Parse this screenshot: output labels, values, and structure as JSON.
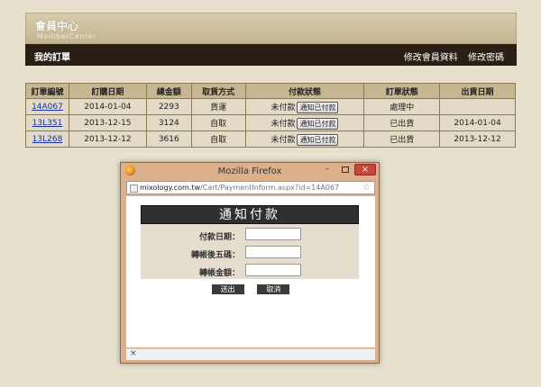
{
  "header": {
    "site_title": "會員中心",
    "site_subtitle": "MemberCenter",
    "page_heading": "我的訂單",
    "links": [
      "修改會員資料",
      "修改密碼"
    ]
  },
  "orders": {
    "columns": [
      "訂單編號",
      "訂購日期",
      "總金額",
      "取貨方式",
      "付款狀態",
      "訂單狀態",
      "出貨日期"
    ],
    "rows": [
      {
        "id": "14A067",
        "order_date": "2014-01-04",
        "total": "2293",
        "delivery": "貨運",
        "payment_status": "未付款",
        "notify_label": "通知已付款",
        "order_status": "處理中",
        "ship_date": ""
      },
      {
        "id": "13L351",
        "order_date": "2013-12-15",
        "total": "3124",
        "delivery": "自取",
        "payment_status": "未付款",
        "notify_label": "通知已付款",
        "order_status": "已出貨",
        "ship_date": "2014-01-04"
      },
      {
        "id": "13L268",
        "order_date": "2013-12-12",
        "total": "3616",
        "delivery": "自取",
        "payment_status": "未付款",
        "notify_label": "通知已付款",
        "order_status": "已出貨",
        "ship_date": "2013-12-12"
      }
    ]
  },
  "popup": {
    "window_title": "Mozilla Firefox",
    "minimize_glyph": "–",
    "close_glyph": "×",
    "url_domain": "mixology.com.tw",
    "url_path": "/Cart/PaymentInform.aspx?id=14A067",
    "star_glyph": "☆",
    "form_title": "通知付款",
    "fields": [
      {
        "label": "付款日期：",
        "value": ""
      },
      {
        "label": "轉帳後五碼：",
        "value": ""
      },
      {
        "label": "轉帳金額：",
        "value": ""
      }
    ],
    "submit_label": "送出",
    "cancel_label": "取消",
    "status_glyph": "×"
  },
  "colors": {
    "page_bg": "#e7e0cd",
    "header_bar": "#2a1f14",
    "table_header": "#c6b792",
    "table_cell": "#e3dbc6",
    "link": "#1a33a8",
    "window_frame": "#dcb08a",
    "close_button": "#c9453c"
  },
  "icons": [
    "firefox-icon",
    "page-icon",
    "star-icon",
    "close-icon",
    "minimize-icon",
    "maximize-icon"
  ]
}
